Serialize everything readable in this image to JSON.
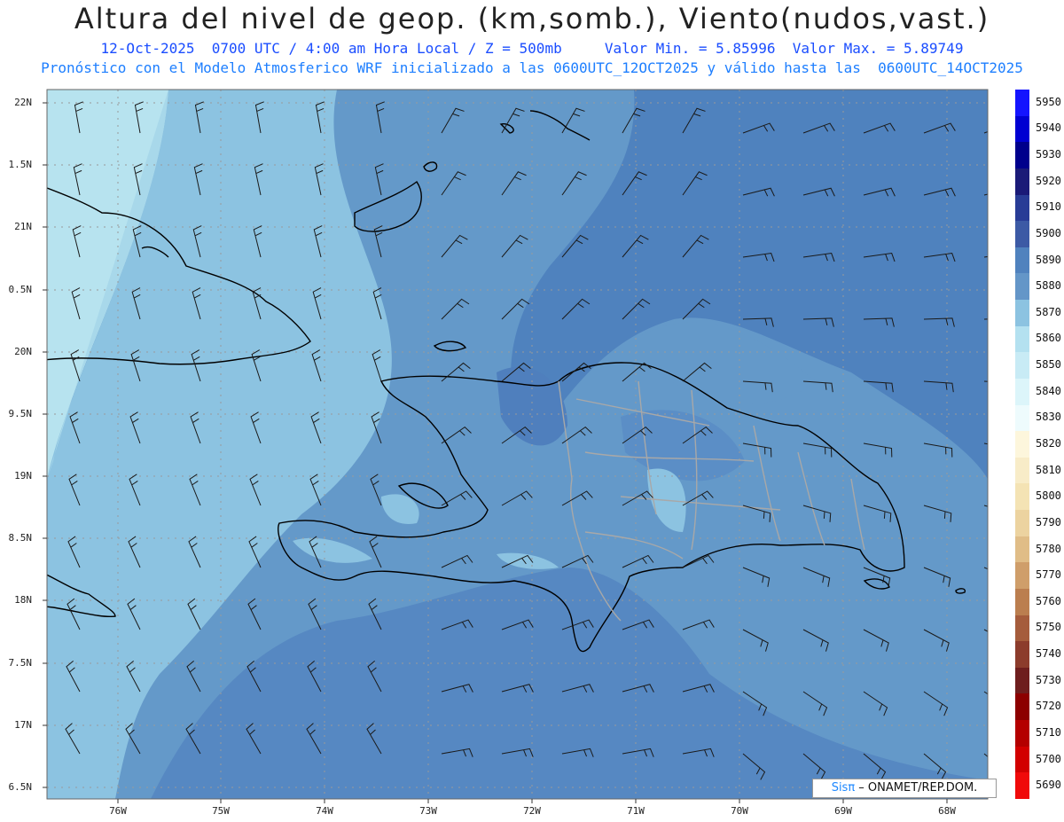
{
  "title": "Altura del nivel de geop. (km,somb.), Viento(nudos,vast.)",
  "subtitle_line1": "12-Oct-2025  0700 UTC / 4:00 am Hora Local / Z = 500mb     Valor Min. = 5.85996  Valor Max. = 5.89749",
  "subtitle_line2": "Pronóstico con el Modelo Atmosferico WRF inicializado a las 0600UTC_12OCT2025 y válido hasta las  0600UTC_14OCT2025",
  "lat_labels": [
    "22N",
    "1.5N",
    "21N",
    "0.5N",
    "20N",
    "9.5N",
    "19N",
    "8.5N",
    "18N",
    "7.5N",
    "17N",
    "6.5N"
  ],
  "lon_labels": [
    "76W",
    "75W",
    "74W",
    "73W",
    "72W",
    "71W",
    "70W",
    "69W",
    "68W"
  ],
  "colorbar": {
    "labels": [
      "5950",
      "5940",
      "5930",
      "5920",
      "5910",
      "5900",
      "5890",
      "5880",
      "5870",
      "5860",
      "5850",
      "5840",
      "5830",
      "5820",
      "5810",
      "5800",
      "5790",
      "5780",
      "5770",
      "5760",
      "5750",
      "5740",
      "5730",
      "5720",
      "5710",
      "5700",
      "5690"
    ],
    "colors": [
      "#1414ff",
      "#0000d2",
      "#00008c",
      "#1a1a78",
      "#283c96",
      "#3c5aa5",
      "#5082be",
      "#6496c8",
      "#8cc3e1",
      "#b4e1f0",
      "#c8ebf5",
      "#dcf5fa",
      "#eefbfd",
      "#fdf6dc",
      "#f8ecc8",
      "#f4e3b4",
      "#ecd3a0",
      "#e0bd87",
      "#cf9e6a",
      "#bb7e4f",
      "#a55c3c",
      "#8c3c2c",
      "#6e1e1e",
      "#8c0000",
      "#b40000",
      "#d20000",
      "#f00a0a"
    ],
    "min": 5.85996,
    "max": 5.89749
  },
  "credit": {
    "brand": "Sisπ",
    "text": " – ONAMET/REP.DOM."
  }
}
